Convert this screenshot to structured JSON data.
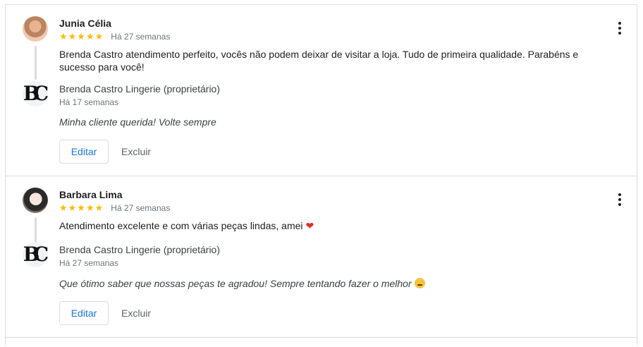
{
  "reviews": [
    {
      "reviewer": "Junia Célia",
      "stars": "★★★★★",
      "rating": 5,
      "time": "Há 27 semanas",
      "text": "Brenda Castro atendimento perfeito, vocês não podem deixar de visitar a loja. Tudo de primeira qualidade. Parabéns e sucesso para você!",
      "owner": {
        "name": "Brenda Castro Lingerie (proprietário)",
        "time": "Há 17 semanas",
        "reply": "Minha cliente querida! Volte sempre"
      },
      "edit_label": "Editar",
      "delete_label": "Excluir"
    },
    {
      "reviewer": "Barbara Lima",
      "stars": "★★★★★",
      "rating": 5,
      "time": "Há 27 semanas",
      "text": "Atendimento excelente e com várias peças lindas, amei",
      "text_emoji": "❤",
      "owner": {
        "name": "Brenda Castro Lingerie (proprietário)",
        "time": "Há 27 semanas",
        "reply": "Que ótimo saber que nossas peças te agradou! Sempre tentando fazer o melhor"
      },
      "edit_label": "Editar",
      "delete_label": "Excluir"
    }
  ],
  "owner_logo": "BC",
  "colors": {
    "star": "#fbbc04",
    "link": "#1a73e8",
    "border": "#dadce0"
  },
  "icons": [
    "more-vert-icon",
    "heart-icon",
    "smile-emoji-icon"
  ]
}
